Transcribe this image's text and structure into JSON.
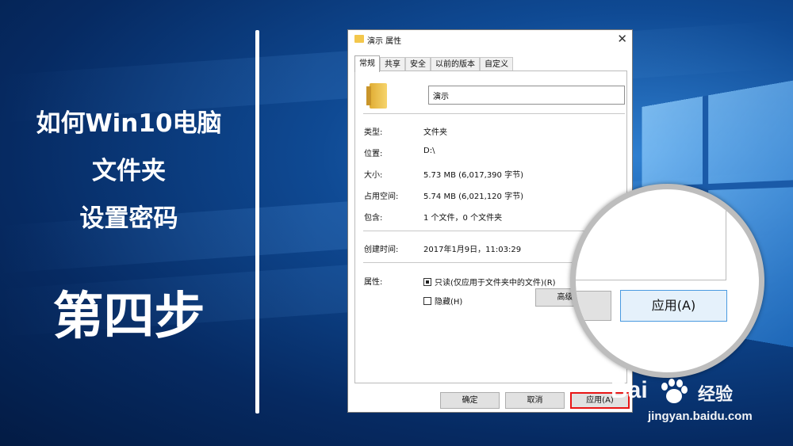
{
  "slide": {
    "title_lines": [
      "如何Win10电脑",
      "文件夹",
      "设置密码"
    ],
    "step": "第四步"
  },
  "dialog": {
    "title": "演示 属性",
    "close_glyph": "✕",
    "tabs": [
      "常规",
      "共享",
      "安全",
      "以前的版本",
      "自定义"
    ],
    "active_tab": "常规",
    "folder_name": "演示",
    "properties": {
      "type_label": "类型:",
      "type_value": "文件夹",
      "location_label": "位置:",
      "location_value": "D:\\",
      "size_label": "大小:",
      "size_value": "5.73 MB (6,017,390 字节)",
      "disk_label": "占用空间:",
      "disk_value": "5.74 MB (6,021,120 字节)",
      "contains_label": "包含:",
      "contains_value": "1 个文件，0 个文件夹",
      "created_label": "创建时间:",
      "created_value": "2017年1月9日，11:03:29",
      "attributes_label": "属性:"
    },
    "readonly_label": "只读(仅应用于文件夹中的文件)(R)",
    "hidden_label": "隐藏(H)",
    "advanced_label": "高级",
    "ok_label": "确定",
    "cancel_label": "取消",
    "apply_label": "应用(A)"
  },
  "magnifier": {
    "apply_label": "应用(A)"
  },
  "watermark": {
    "logo_text": "Bai",
    "brand_text": "经验",
    "url": "jingyan.baidu.com"
  },
  "colors": {
    "highlight": "#e81515",
    "accent": "#4a9ae0",
    "folder": "#f3c74c"
  }
}
